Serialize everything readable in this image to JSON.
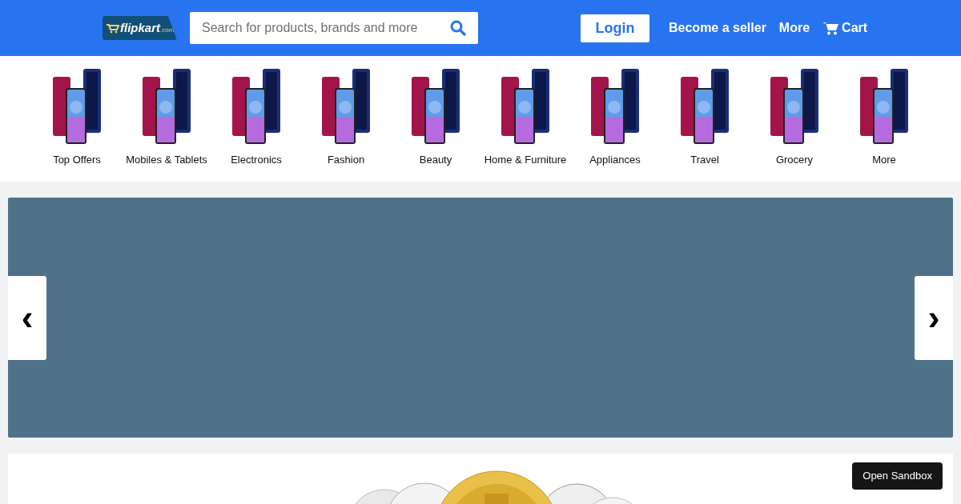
{
  "header": {
    "logo": {
      "name": "flipkart",
      "suffix": ".com"
    },
    "search": {
      "placeholder": "Search for products, brands and more"
    },
    "login_button": "Login",
    "links": [
      "Become a seller",
      "More"
    ],
    "cart": "Cart"
  },
  "categories": [
    {
      "label": "Top Offers"
    },
    {
      "label": "Mobiles & Tablets"
    },
    {
      "label": "Electronics"
    },
    {
      "label": "Fashion"
    },
    {
      "label": "Beauty"
    },
    {
      "label": "Home & Furniture"
    },
    {
      "label": "Appliances"
    },
    {
      "label": "Travel"
    },
    {
      "label": "Grocery"
    },
    {
      "label": "More"
    }
  ],
  "carousel": {
    "prev": "‹",
    "next": "›"
  },
  "sandbox_button": "Open Sandbox"
}
